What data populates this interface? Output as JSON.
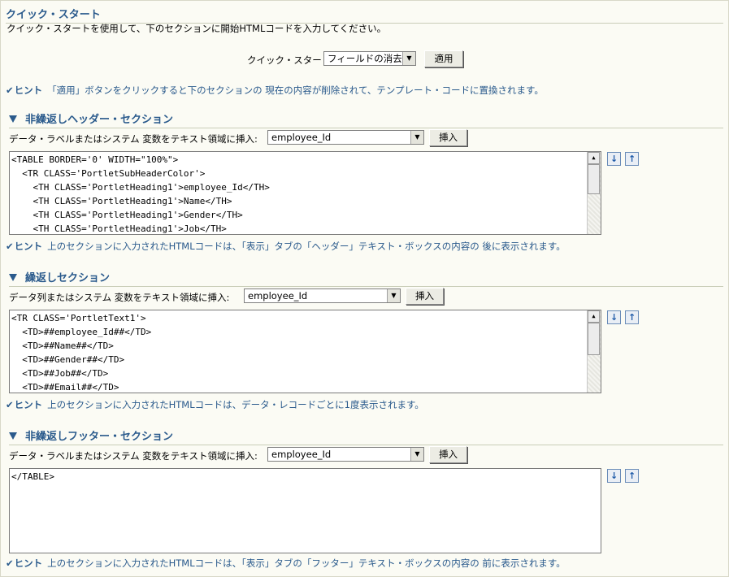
{
  "quick_start": {
    "title": "クイック・スタート",
    "description": "クイック・スタートを使用して、下のセクションに開始HTMLコードを入力してください。",
    "select_label": "クイック・スタート",
    "select_value": "フィールドの消去",
    "apply_button": "適用",
    "hint_label": "ヒント",
    "hint_text": "「適用」ボタンをクリックすると下のセクションの 現在の内容が削除されて、テンプレート・コードに置換されます。"
  },
  "header_section": {
    "title": "非繰返しヘッダー・セクション",
    "insert_label": "データ・ラベルまたはシステム 変数をテキスト領域に挿入:",
    "select_value": "employee_Id",
    "insert_button": "挿入",
    "code": "<TABLE BORDER='0' WIDTH=\"100%\">\n  <TR CLASS='PortletSubHeaderColor'>\n    <TH CLASS='PortletHeading1'>employee_Id</TH>\n    <TH CLASS='PortletHeading1'>Name</TH>\n    <TH CLASS='PortletHeading1'>Gender</TH>\n    <TH CLASS='PortletHeading1'>Job</TH>",
    "hint_label": "ヒント",
    "hint_text": "上のセクションに入力されたHTMLコードは、「表示」タブの「ヘッダー」テキスト・ボックスの内容の 後に表示されます。"
  },
  "repeat_section": {
    "title": "繰返しセクション",
    "insert_label": "データ列またはシステム 変数をテキスト領域に挿入:",
    "select_value": "employee_Id",
    "insert_button": "挿入",
    "code": "<TR CLASS='PortletText1'>\n  <TD>##employee_Id##</TD>\n  <TD>##Name##</TD>\n  <TD>##Gender##</TD>\n  <TD>##Job##</TD>\n  <TD>##Email##</TD>",
    "hint_label": "ヒント",
    "hint_text": "上のセクションに入力されたHTMLコードは、データ・レコードごとに1度表示されます。"
  },
  "footer_section": {
    "title": "非繰返しフッター・セクション",
    "insert_label": "データ・ラベルまたはシステム 変数をテキスト領域に挿入:",
    "select_value": "employee_Id",
    "insert_button": "挿入",
    "code": "</TABLE>",
    "hint_label": "ヒント",
    "hint_text": "上のセクションに入力されたHTMLコードは、「表示」タブの「フッター」テキスト・ボックスの内容の 前に表示されます。"
  },
  "colors": {
    "accent": "#2a5a8c",
    "background": "#fbfbf4"
  },
  "icons": {
    "expand": "expand-down-icon",
    "collapse": "collapse-up-icon",
    "hint": "hint-check-icon",
    "section": "section-triangle-icon"
  }
}
